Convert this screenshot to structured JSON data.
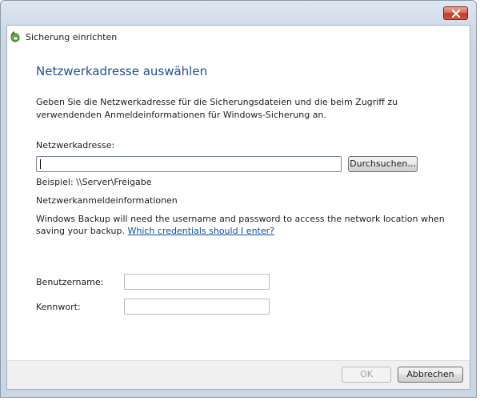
{
  "window": {
    "title": "Sicherung einrichten",
    "close_icon": "close-icon"
  },
  "page": {
    "heading": "Netzwerkadresse auswählen",
    "description": "Geben Sie die Netzwerkadresse für die Sicherungsdateien und die beim Zugriff zu verwendenden Anmeldeinformationen für Windows-Sicherung an."
  },
  "network_address": {
    "label": "Netzwerkadresse:",
    "value": "",
    "browse_label": "Durchsuchen...",
    "example": "Beispiel: \\\\Server\\Freigabe"
  },
  "credentials": {
    "section_label": "Netzwerkanmeldeinformationen",
    "info_text": "Windows Backup will need the username and password to access the network location when saving your backup.",
    "help_link": "Which credentials should I enter?",
    "username_label": "Benutzername:",
    "username_value": "",
    "password_label": "Kennwort:",
    "password_value": ""
  },
  "footer": {
    "ok_label": "OK",
    "cancel_label": "Abbrechen"
  },
  "colors": {
    "heading": "#1e4f8f",
    "link": "#0a4ea0",
    "close_button": "#c0341f"
  }
}
